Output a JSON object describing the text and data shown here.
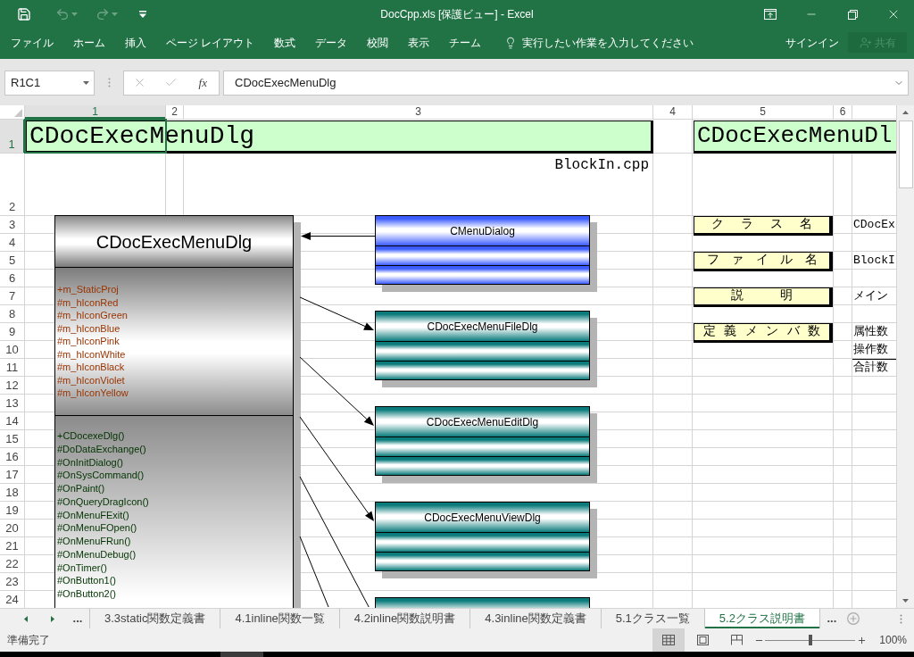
{
  "window": {
    "title": "DocCpp.xls [保護ビュー] - Excel"
  },
  "quick_access": [
    {
      "kind": "save",
      "disabled": false
    },
    {
      "kind": "undo",
      "disabled": true
    },
    {
      "kind": "redo",
      "disabled": true
    },
    {
      "kind": "customize",
      "disabled": false
    }
  ],
  "ribbon": {
    "tabs": [
      {
        "label": "ファイル",
        "selected": false
      },
      {
        "label": "ホーム",
        "selected": false
      },
      {
        "label": "挿入",
        "selected": false
      },
      {
        "label": "ページ レイアウト",
        "selected": false
      },
      {
        "label": "数式",
        "selected": false
      },
      {
        "label": "データ",
        "selected": false
      },
      {
        "label": "校閲",
        "selected": false
      },
      {
        "label": "表示",
        "selected": false
      },
      {
        "label": "チーム",
        "selected": false
      }
    ],
    "tell_me": "実行したい作業を入力してください",
    "sign_in": "サインイン",
    "share": {
      "label": "共有",
      "disabled": true
    }
  },
  "formula_bar": {
    "name_box": "R1C1",
    "buttons": [
      {
        "kind": "cancel",
        "disabled": true
      },
      {
        "kind": "enter",
        "disabled": true
      }
    ],
    "function_button": "fx",
    "formula": "CDocExecMenuDlg"
  },
  "sheet": {
    "columns": [
      {
        "label": "1",
        "selected": true
      },
      {
        "label": "2",
        "selected": false
      },
      {
        "label": "3",
        "selected": false
      },
      {
        "label": "4",
        "selected": false
      },
      {
        "label": "5",
        "selected": false
      },
      {
        "label": "6",
        "selected": false
      }
    ],
    "rows": [
      {
        "label": "1",
        "selected": true
      },
      {
        "label": "2",
        "selected": false
      },
      {
        "label": "3",
        "selected": false
      },
      {
        "label": "4",
        "selected": false
      },
      {
        "label": "5",
        "selected": false
      },
      {
        "label": "6",
        "selected": false
      },
      {
        "label": "7",
        "selected": false
      },
      {
        "label": "8",
        "selected": false
      },
      {
        "label": "9",
        "selected": false
      },
      {
        "label": "10",
        "selected": false
      },
      {
        "label": "11",
        "selected": false
      },
      {
        "label": "12",
        "selected": false
      },
      {
        "label": "13",
        "selected": false
      },
      {
        "label": "14",
        "selected": false
      },
      {
        "label": "15",
        "selected": false
      },
      {
        "label": "16",
        "selected": false
      },
      {
        "label": "17",
        "selected": false
      },
      {
        "label": "18",
        "selected": false
      },
      {
        "label": "19",
        "selected": false
      },
      {
        "label": "20",
        "selected": false
      },
      {
        "label": "21",
        "selected": false
      },
      {
        "label": "22",
        "selected": false
      },
      {
        "label": "23",
        "selected": false
      },
      {
        "label": "24",
        "selected": false
      }
    ],
    "title_cell": {
      "text": "CDocExecMenuDlg",
      "selected": true
    },
    "file_cell": "BlockIn.cpp",
    "side_title": "CDocExecMenuDl",
    "info": [
      {
        "label": "クラス名",
        "values": [
          {
            "text": "CDocEx",
            "kind": "plain"
          }
        ]
      },
      {
        "label": "ファイル名",
        "values": [
          {
            "text": "BlockI",
            "kind": "plain"
          }
        ]
      },
      {
        "label": "説明",
        "values": [
          {
            "text": "メイン",
            "kind": "plain"
          }
        ]
      },
      {
        "label": "定義メンバ数",
        "values": [
          {
            "text": "属性数",
            "kind": "plain"
          },
          {
            "text": "操作数",
            "kind": "plain"
          },
          {
            "text": "合計数",
            "kind": "total"
          }
        ]
      }
    ]
  },
  "diagram": {
    "main_class": {
      "name": "CDocExecMenuDlg",
      "attributes": [
        "+m_StaticProj",
        "#m_hIconRed",
        "#m_hIconGreen",
        "#m_hIconBlue",
        "#m_hIconPink",
        "#m_hIconWhite",
        "#m_hIconBlack",
        "#m_hIconViolet",
        "#m_hIconYellow"
      ],
      "operations": [
        "+CDocexeDlg()",
        "#DoDataExchange()",
        "#OnInitDialog()",
        "#OnSysCommand()",
        "#OnPaint()",
        "#OnQueryDragIcon()",
        "#OnMenuFExit()",
        "#OnMenuFOpen()",
        "#OnMenuFRun()",
        "#OnMenuDebug()",
        "#OnTimer()",
        "#OnButton1()",
        "#OnButton2()"
      ]
    },
    "related_classes": [
      {
        "name": "CMenuDialog",
        "color": "#3c5cff",
        "kind": "inbound"
      },
      {
        "name": "CDocExecMenuFileDlg",
        "color": "#0b7b7b",
        "kind": "outbound"
      },
      {
        "name": "CDocExecMenuEditDlg",
        "color": "#0b7b7b",
        "kind": "outbound"
      },
      {
        "name": "CDocExecMenuViewDlg",
        "color": "#0b7b7b",
        "kind": "outbound"
      },
      {
        "color": "#0b7b7b",
        "kind": "outbound"
      }
    ]
  },
  "sheet_tabs": {
    "more_left": "...",
    "tabs": [
      {
        "label": "3.3static関数定義書",
        "selected": false
      },
      {
        "label": "4.1inline関数一覧",
        "selected": false
      },
      {
        "label": "4.2inline関数説明書",
        "selected": false
      },
      {
        "label": "4.3inline関数定義書",
        "selected": false
      },
      {
        "label": "5.1クラス一覧",
        "selected": false
      },
      {
        "label": "5.2クラス説明書",
        "selected": true
      }
    ],
    "more_right": "..."
  },
  "status_bar": {
    "status": "準備完了",
    "views": [
      {
        "kind": "normal",
        "selected": true
      },
      {
        "kind": "page_layout",
        "selected": false
      },
      {
        "kind": "page_break",
        "selected": false
      }
    ],
    "zoom": {
      "label": "100%",
      "level": 0.5
    }
  }
}
